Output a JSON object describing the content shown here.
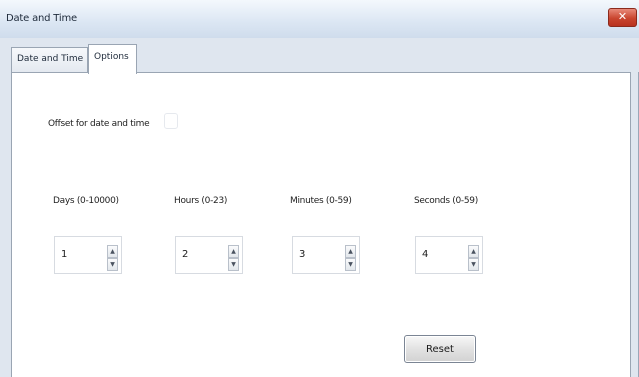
{
  "window": {
    "title": "Date and Time",
    "close_glyph": "✕"
  },
  "tabs": [
    {
      "label": "Date and Time",
      "active": false
    },
    {
      "label": "Options",
      "active": true
    }
  ],
  "options": {
    "offset_label": "Offset for date and time",
    "fields": [
      {
        "label": "Days (0-10000)",
        "value": "1"
      },
      {
        "label": "Hours (0-23)",
        "value": "2"
      },
      {
        "label": "Minutes (0-59)",
        "value": "3"
      },
      {
        "label": "Seconds (0-59)",
        "value": "4"
      }
    ],
    "spin_up_glyph": "▲",
    "spin_down_glyph": "▼",
    "reset_label": "Reset"
  }
}
